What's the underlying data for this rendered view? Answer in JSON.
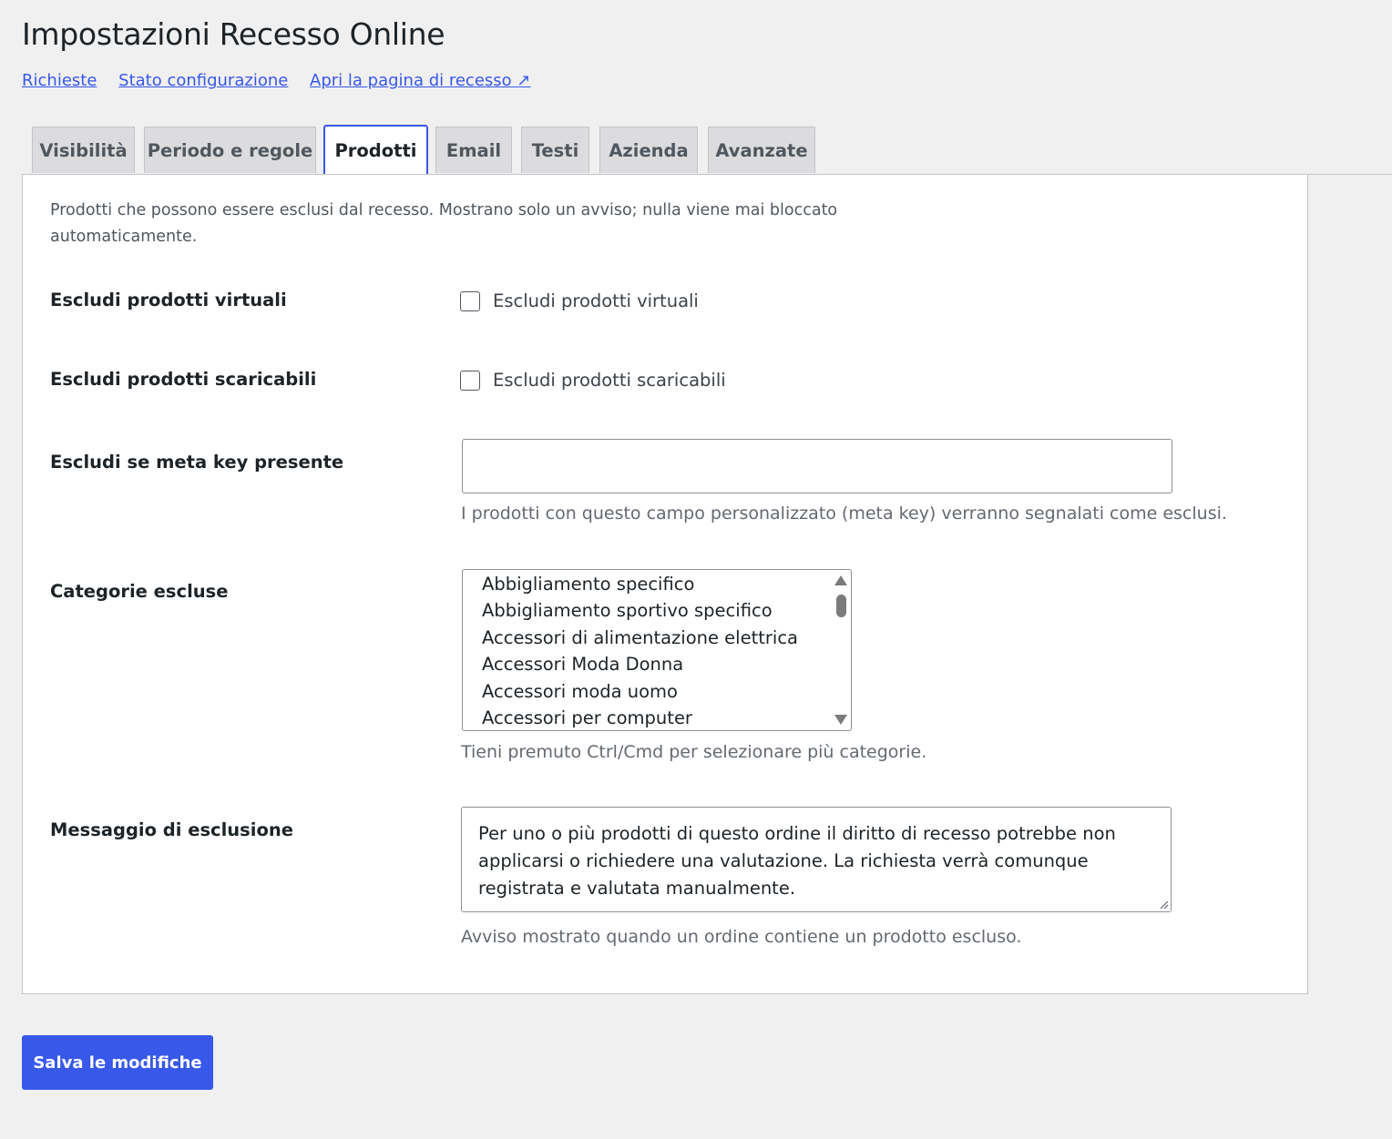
{
  "page": {
    "title": "Impostazioni Recesso Online"
  },
  "links": [
    {
      "label": "Richieste"
    },
    {
      "label": "Stato configurazione"
    },
    {
      "label": "Apri la pagina di recesso ↗"
    }
  ],
  "tabs": [
    {
      "label": "Visibilità",
      "active": false
    },
    {
      "label": "Periodo e regole",
      "active": false
    },
    {
      "label": "Prodotti",
      "active": true
    },
    {
      "label": "Email",
      "active": false
    },
    {
      "label": "Testi",
      "active": false
    },
    {
      "label": "Azienda",
      "active": false
    },
    {
      "label": "Avanzate",
      "active": false
    }
  ],
  "panel": {
    "intro": "Prodotti che possono essere esclusi dal recesso. Mostrano solo un avviso; nulla viene mai bloccato automaticamente.",
    "virtual": {
      "label": "Escludi prodotti virtuali",
      "checkbox_label": "Escludi prodotti virtuali",
      "checked": false
    },
    "downloadable": {
      "label": "Escludi prodotti scaricabili",
      "checkbox_label": "Escludi prodotti scaricabili",
      "checked": false
    },
    "meta_key": {
      "label": "Escludi se meta key presente",
      "value": "",
      "help": "I prodotti con questo campo personalizzato (meta key) verranno segnalati come esclusi."
    },
    "categories": {
      "label": "Categorie escluse",
      "options": [
        "Abbigliamento specifico",
        "Abbigliamento sportivo specifico",
        "Accessori di alimentazione elettrica",
        "Accessori Moda Donna",
        "Accessori moda uomo",
        "Accessori per computer"
      ],
      "help": "Tieni premuto Ctrl/Cmd per selezionare più categorie."
    },
    "message": {
      "label": "Messaggio di esclusione",
      "value": "Per uno o più prodotti di questo ordine il diritto di recesso potrebbe non applicarsi o richiedere una valutazione. La richiesta verrà comunque registrata e valutata manualmente.",
      "help": "Avviso mostrato quando un ordine contiene un prodotto escluso."
    }
  },
  "save_button": {
    "label": "Salva le modifiche"
  },
  "colors": {
    "accent": "#3858e9",
    "background": "#f0f0f1",
    "panel": "#ffffff"
  }
}
